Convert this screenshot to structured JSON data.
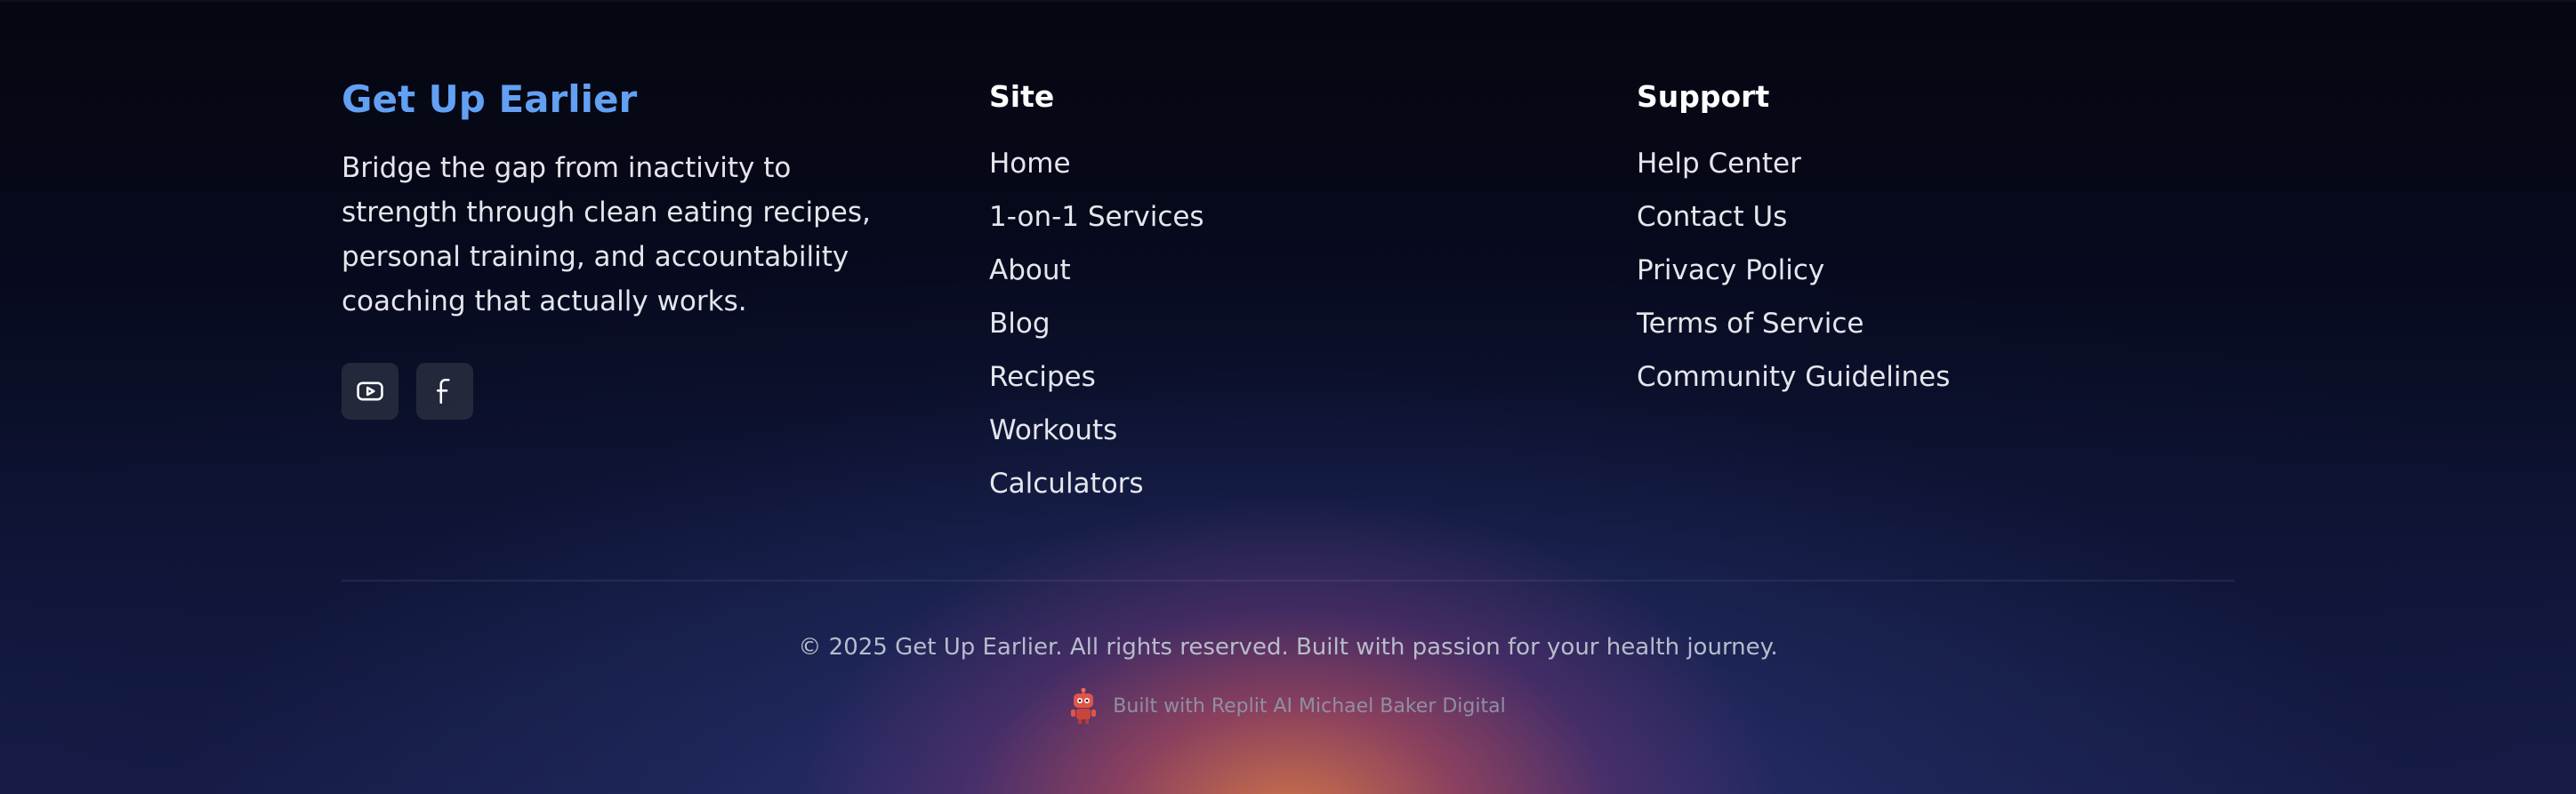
{
  "brand": {
    "title": "Get Up Earlier",
    "description": "Bridge the gap from inactivity to strength through clean eating recipes, personal training, and accountability coaching that actually works.",
    "title_color": "#62a0f3"
  },
  "socials": [
    {
      "icon": "youtube-icon"
    },
    {
      "icon": "facebook-icon"
    }
  ],
  "site": {
    "heading": "Site",
    "links": [
      "Home",
      "1-on-1 Services",
      "About",
      "Blog",
      "Recipes",
      "Workouts",
      "Calculators"
    ]
  },
  "support": {
    "heading": "Support",
    "links": [
      "Help Center",
      "Contact Us",
      "Privacy Policy",
      "Terms of Service",
      "Community Guidelines"
    ]
  },
  "footer": {
    "copyright": "© 2025 Get Up Earlier. All rights reserved. Built with passion for your health journey.",
    "built_with": "Built with Replit AI Michael Baker Digital",
    "built_with_icon": "replit-robot-icon"
  }
}
